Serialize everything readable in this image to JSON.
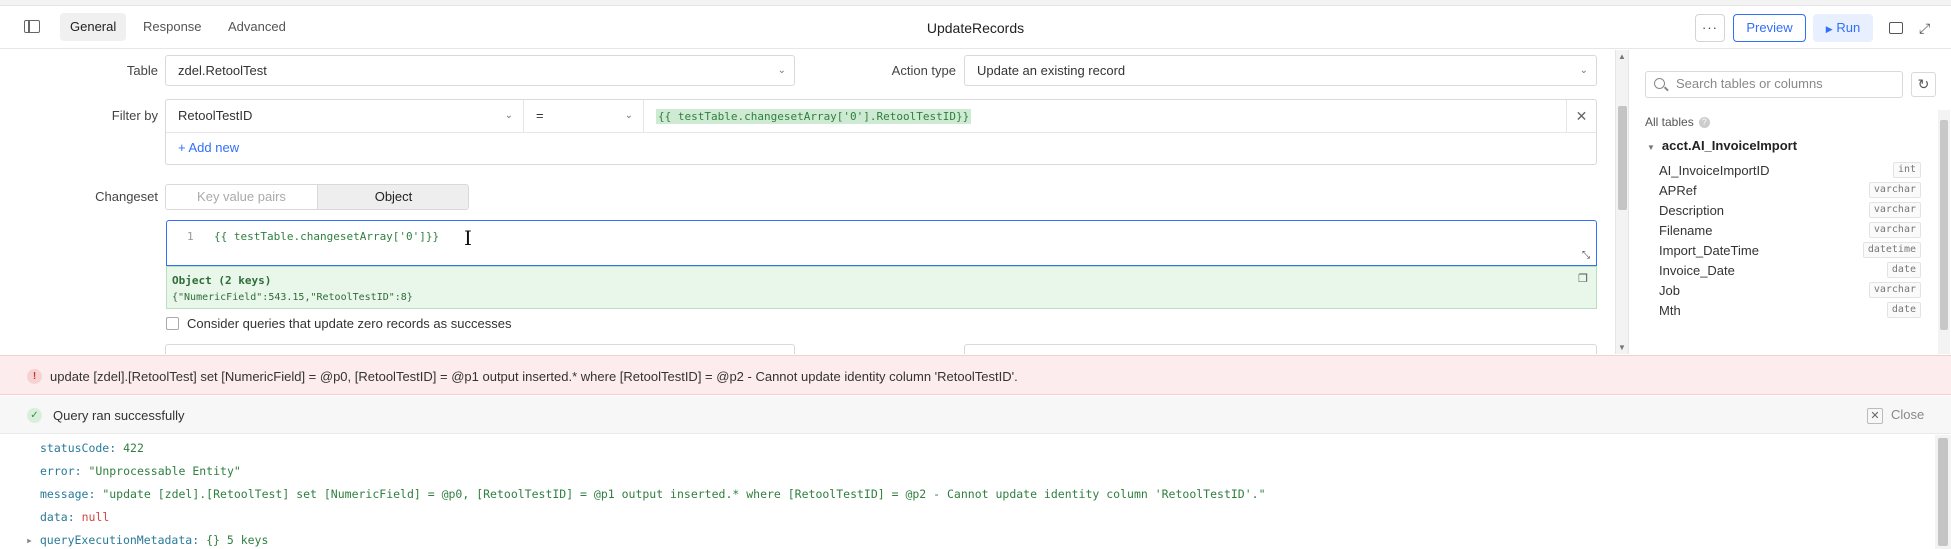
{
  "header": {
    "tabs": [
      "General",
      "Response",
      "Advanced"
    ],
    "active_tab": "General",
    "title": "UpdateRecords",
    "more_label": "···",
    "preview_label": "Preview",
    "run_label": "Run"
  },
  "form": {
    "table_label": "Table",
    "table_value": "zdel.RetoolTest",
    "action_type_label": "Action type",
    "action_type_value": "Update an existing record",
    "filter_label": "Filter by",
    "filter_column": "RetoolTestID",
    "filter_operator": "=",
    "filter_value": "{{ testTable.changesetArray['0'].RetoolTestID}}",
    "add_new_label": "+ Add new",
    "changeset_label": "Changeset",
    "changeset_options": [
      "Key value pairs",
      "Object"
    ],
    "changeset_selected": "Object",
    "editor_line_number": "1",
    "editor_code": "{{ testTable.changesetArray['0']}}",
    "eval_title": "Object (2 keys)",
    "eval_value": "{\"NumericField\":543.15,\"RetoolTestID\":8}",
    "zero_records_label": "Consider queries that update zero records as successes"
  },
  "schema": {
    "search_placeholder": "Search tables or columns",
    "all_tables_label": "All tables",
    "table_name": "acct.AI_InvoiceImport",
    "columns": [
      {
        "name": "AI_InvoiceImportID",
        "type": "int"
      },
      {
        "name": "APRef",
        "type": "varchar"
      },
      {
        "name": "Description",
        "type": "varchar"
      },
      {
        "name": "Filename",
        "type": "varchar"
      },
      {
        "name": "Import_DateTime",
        "type": "datetime"
      },
      {
        "name": "Invoice_Date",
        "type": "date"
      },
      {
        "name": "Job",
        "type": "varchar"
      },
      {
        "name": "Mth",
        "type": "date"
      }
    ]
  },
  "error": {
    "message": "update [zdel].[RetoolTest] set [NumericField] = @p0, [RetoolTestID] = @p1 output inserted.* where [RetoolTestID] = @p2 - Cannot update identity column 'RetoolTestID'."
  },
  "status": {
    "message": "Query ran successfully",
    "close_label": "Close"
  },
  "response": {
    "status_code_key": "statusCode:",
    "status_code": "422",
    "error_key": "error:",
    "error_value": "\"Unprocessable Entity\"",
    "message_key": "message:",
    "message_value": "\"update [zdel].[RetoolTest] set [NumericField] = @p0, [RetoolTestID] = @p1 output inserted.* where [RetoolTestID] = @p2 - Cannot update identity column 'RetoolTestID'.\"",
    "data_key": "data:",
    "data_value": "null",
    "meta_key": "queryExecutionMetadata:",
    "meta_value": "{}",
    "meta_count": "5 keys"
  }
}
